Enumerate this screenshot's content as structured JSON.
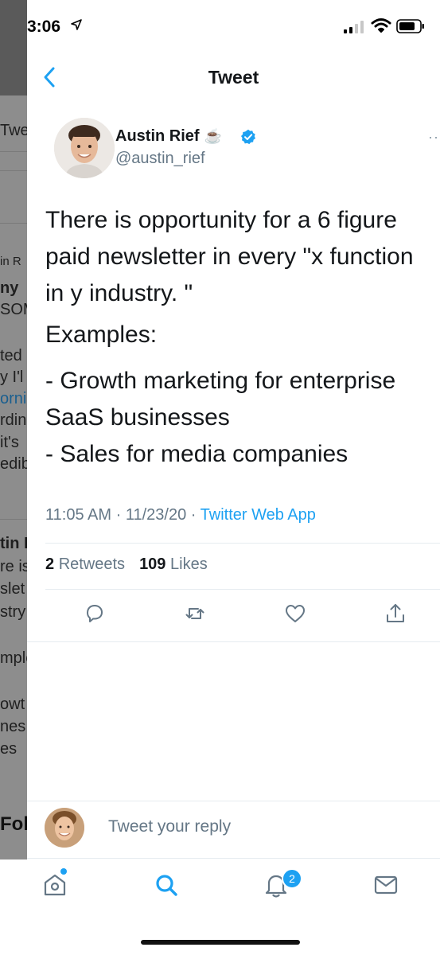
{
  "background_screen": {
    "fragments": [
      "Twe",
      "in R",
      "ny",
      "SOM",
      "ted",
      "y I'l",
      "orni",
      "rdin",
      "it's",
      "edib",
      "tin F",
      "re is",
      "slet",
      "stry",
      "mple",
      "owt",
      "nes",
      "es",
      "Foll"
    ]
  },
  "status_bar": {
    "time": "3:06",
    "icons": [
      "location-arrow-icon",
      "cellular-signal-icon",
      "wifi-icon",
      "battery-icon"
    ]
  },
  "header": {
    "title": "Tweet",
    "back_icon": "chevron-left-icon"
  },
  "author": {
    "name": "Austin Rief",
    "emoji": "☕",
    "handle": "@austin_rief",
    "verified": true
  },
  "tweet": {
    "lines": [
      "There is opportunity for a 6 figure",
      "paid newsletter in every \"x function",
      "in y industry. \""
    ],
    "examples_heading": "Examples:",
    "examples": [
      "- Growth marketing for enterprise",
      "SaaS businesses",
      "- Sales for media companies"
    ]
  },
  "meta": {
    "time": "11:05 AM",
    "separator": "·",
    "date": "11/23/20",
    "source": "Twitter Web App"
  },
  "stats": {
    "retweets_count": "2",
    "retweets_label": "Retweets",
    "likes_count": "109",
    "likes_label": "Likes"
  },
  "actions": [
    "reply-icon",
    "retweet-icon",
    "like-icon",
    "share-icon"
  ],
  "reply": {
    "placeholder": "Tweet your reply"
  },
  "tabbar": {
    "items": [
      "home-icon",
      "search-icon",
      "notifications-icon",
      "messages-icon"
    ],
    "notification_badge": "2"
  },
  "colors": {
    "accent": "#1da1f2",
    "text": "#14171a",
    "muted": "#657786",
    "divider": "#e6ecf0"
  }
}
